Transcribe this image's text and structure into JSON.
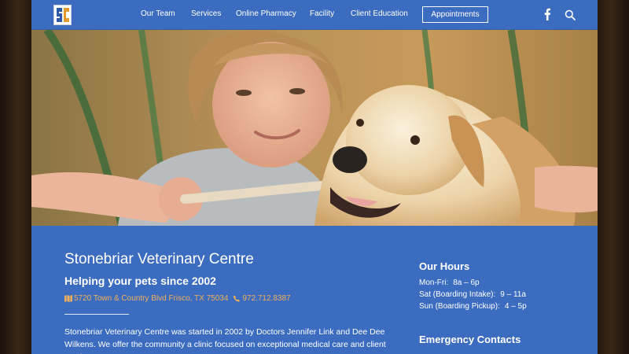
{
  "header": {
    "logo_text": "SC",
    "nav": [
      {
        "label": "Our Team"
      },
      {
        "label": "Services"
      },
      {
        "label": "Online Pharmacy"
      },
      {
        "label": "Facility"
      },
      {
        "label": "Client Education"
      }
    ],
    "appointments_label": "Appointments",
    "icons": [
      "facebook-icon",
      "search-icon"
    ]
  },
  "hero": {
    "image": "boy-with-golden-retriever-photo"
  },
  "main": {
    "title": "Stonebriar Veterinary Centre",
    "subtitle": "Helping your pets since 2002",
    "address": "5720 Town & Country Blvd Frisco, TX 75034",
    "phone": "972.712.8387",
    "about": "Stonebriar Veterinary Centre was started in 2002 by Doctors Jennifer Link and Dee Dee Wilkens. We offer the community a clinic focused on exceptional medical care and client service."
  },
  "sidebar": {
    "hours_title": "Our Hours",
    "hours": [
      {
        "label": "Mon-Fri:",
        "time": "8a – 6p"
      },
      {
        "label": "Sat (Boarding Intake):",
        "time": "9 – 11a"
      },
      {
        "label": "Sun (Boarding Pickup):",
        "time": "4 – 5p"
      }
    ],
    "emergency_title": "Emergency Contacts"
  },
  "colors": {
    "accent": "#3c6cbf",
    "link": "#f0b05a",
    "text": "#ffffff"
  }
}
